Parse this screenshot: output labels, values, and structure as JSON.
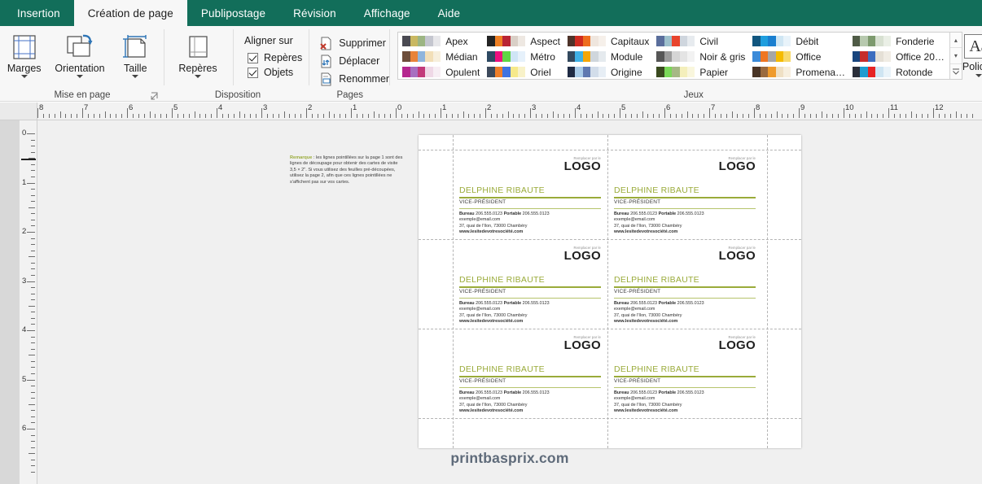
{
  "app": {
    "name": "Microsoft Publisher",
    "accent_color": "#126e5a",
    "card_accent_color": "#9aab3a"
  },
  "tabs": [
    {
      "label": "Insertion",
      "active": false
    },
    {
      "label": "Création de page",
      "active": true
    },
    {
      "label": "Publipostage",
      "active": false
    },
    {
      "label": "Révision",
      "active": false
    },
    {
      "label": "Affichage",
      "active": false
    },
    {
      "label": "Aide",
      "active": false
    }
  ],
  "ribbon": {
    "groups": [
      {
        "title": "Mise en page",
        "has_dialog_launcher": true,
        "buttons": [
          {
            "label": "Marges",
            "icon": "margins-icon",
            "has_caret": true
          },
          {
            "label": "Orientation",
            "icon": "orientation-icon",
            "has_caret": true
          },
          {
            "label": "Taille",
            "icon": "size-icon",
            "has_caret": true
          }
        ]
      },
      {
        "title": "Disposition",
        "has_dialog_launcher": false,
        "buttons": [
          {
            "label": "Repères",
            "icon": "guides-icon",
            "has_caret": true
          }
        ],
        "align_header": "Aligner sur",
        "checkboxes": [
          {
            "label": "Repères",
            "checked": true
          },
          {
            "label": "Objets",
            "checked": true
          }
        ]
      },
      {
        "title": "Pages",
        "has_dialog_launcher": false,
        "commands": [
          {
            "label": "Supprimer",
            "icon": "delete-page-icon"
          },
          {
            "label": "Déplacer",
            "icon": "move-page-icon"
          },
          {
            "label": "Renommer",
            "icon": "rename-page-icon"
          }
        ]
      },
      {
        "title": "Jeux",
        "has_dialog_launcher": false
      }
    ],
    "themes": [
      {
        "name": "Apex",
        "colors": [
          "#4a4a52",
          "#c9b861",
          "#9cb583",
          "#c4c6cf",
          "#e7e7ea"
        ]
      },
      {
        "name": "Médian",
        "colors": [
          "#6e4e3b",
          "#e8833a",
          "#8fb5dd",
          "#f2dfb8",
          "#f7efdd"
        ]
      },
      {
        "name": "Opulent",
        "colors": [
          "#b5278f",
          "#a86fc0",
          "#c23a7a",
          "#efd8e6",
          "#f7eef4"
        ]
      },
      {
        "name": "Aspect",
        "colors": [
          "#242424",
          "#ef8023",
          "#b92433",
          "#d9cfc6",
          "#eee8e2"
        ]
      },
      {
        "name": "Métro",
        "colors": [
          "#2e4a63",
          "#ec0f7e",
          "#5fd544",
          "#cfe5f6",
          "#e6f1fb"
        ]
      },
      {
        "name": "Oriel",
        "colors": [
          "#3d4a5c",
          "#ef7f2a",
          "#3f73e0",
          "#f6e98a",
          "#f8f2c9"
        ]
      },
      {
        "name": "Capitaux",
        "colors": [
          "#4e3329",
          "#cf2b20",
          "#ee6d1e",
          "#efe6de",
          "#f6f0ea"
        ]
      },
      {
        "name": "Module",
        "colors": [
          "#33495e",
          "#3fb0e6",
          "#f5a608",
          "#cfd6dc",
          "#e5eaee"
        ]
      },
      {
        "name": "Origine",
        "colors": [
          "#1f2b44",
          "#a9cbe8",
          "#5f78b0",
          "#d2ddea",
          "#e7eef5"
        ]
      },
      {
        "name": "Civil",
        "colors": [
          "#5a6e9c",
          "#9dc0cc",
          "#e8442d",
          "#cfd6de",
          "#e7ebef"
        ]
      },
      {
        "name": "Noir & gris",
        "colors": [
          "#565656",
          "#9b9b9b",
          "#d5d5d5",
          "#e4e4e4",
          "#f2f2f2"
        ]
      },
      {
        "name": "Papier",
        "colors": [
          "#3a4a1f",
          "#7ad858",
          "#a6b885",
          "#f4efbb",
          "#f9f6dd"
        ]
      },
      {
        "name": "Débit",
        "colors": [
          "#11567f",
          "#1f9ede",
          "#1a7fd0",
          "#cfe6f3",
          "#e8f3fa"
        ]
      },
      {
        "name": "Office",
        "colors": [
          "#3b8ad8",
          "#ef7622",
          "#a6a6a6",
          "#f5bb00",
          "#f7d96b"
        ]
      },
      {
        "name": "Promena…",
        "colors": [
          "#4a3526",
          "#9a6a3e",
          "#ef9b2c",
          "#efe0c4",
          "#f7efdf"
        ]
      },
      {
        "name": "Fonderie",
        "colors": [
          "#4f5b46",
          "#b7c9ae",
          "#7d9a6e",
          "#d7e0d1",
          "#eaefe6"
        ]
      },
      {
        "name": "Office 20…",
        "colors": [
          "#18457e",
          "#c62c2c",
          "#3c6dbf",
          "#e5e0d6",
          "#f0ece4"
        ]
      },
      {
        "name": "Rotonde",
        "colors": [
          "#2b2f3a",
          "#1f9cd0",
          "#e62424",
          "#cfe5f2",
          "#e9f3f9"
        ]
      }
    ],
    "fonts_button": {
      "label": "Polices",
      "glyph": "Aa",
      "has_caret": true
    },
    "gallery_scroll": {
      "up": "▴",
      "down": "▾",
      "more": "▾"
    }
  },
  "rulers": {
    "horizontal_ticks": [
      "8",
      "7",
      "6",
      "5",
      "4",
      "3",
      "2",
      "1",
      "0",
      "1",
      "2",
      "3",
      "4",
      "5",
      "6",
      "7",
      "8",
      "9",
      "10",
      "11",
      "12"
    ],
    "vertical_ticks": [
      "0",
      "1",
      "2",
      "3",
      "4",
      "5",
      "6"
    ],
    "unit": "in"
  },
  "canvas": {
    "watermark": "printbasprix.com",
    "remark": {
      "label": "Remarque",
      "text": " : les lignes pointillées sur la page 1 sont des lignes de découpage pour obtenir des cartes de visite 3,5 × 2\". Si vous utilisez des feuilles pré-découpées, utilisez la page 2, afin que ces lignes pointillées ne s'affichent pas sur vos cartes."
    },
    "card": {
      "logo_sub": "Remplacer par le",
      "logo_main": "LOGO",
      "name": "DELPHINE RIBAUTE",
      "title": "VICE-PRÉSIDENT",
      "phone_office_label": "Bureau",
      "phone_office": "206.555.0123",
      "phone_mobile_label": "Portable",
      "phone_mobile": "206.555.0123",
      "email": "exemple@email.com",
      "address": "37, quai de l'Ilon, 73000 Chambéry",
      "website": "www.lesitedevotresociété.com"
    },
    "card_count": 6
  }
}
